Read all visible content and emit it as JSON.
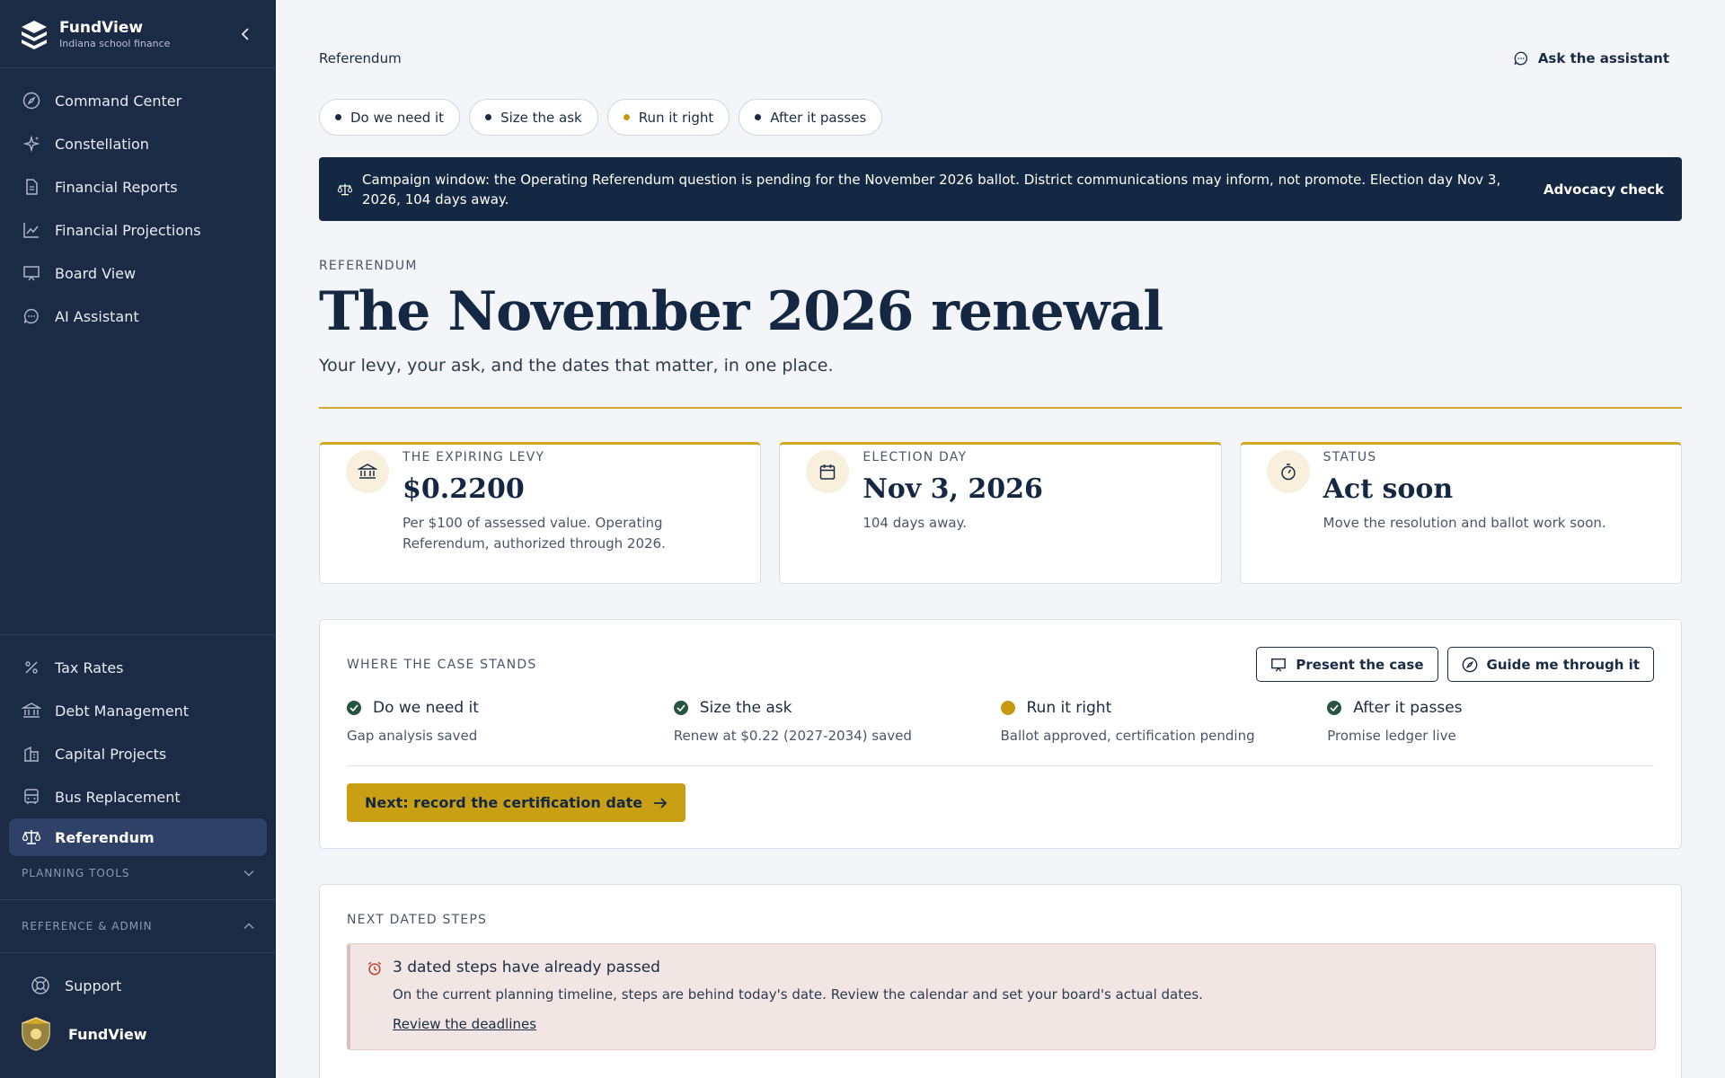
{
  "app": {
    "name": "FundView",
    "tagline": "Indiana school finance"
  },
  "sidebar": {
    "primary": [
      {
        "label": "Command Center",
        "icon": "compass-icon"
      },
      {
        "label": "Constellation",
        "icon": "sparkle-icon"
      },
      {
        "label": "Financial Reports",
        "icon": "document-icon"
      },
      {
        "label": "Financial Projections",
        "icon": "trend-chart-icon"
      },
      {
        "label": "Board View",
        "icon": "presentation-icon"
      },
      {
        "label": "AI Assistant",
        "icon": "chat-icon"
      }
    ],
    "secondary": [
      {
        "label": "Tax Rates",
        "icon": "percent-icon"
      },
      {
        "label": "Debt Management",
        "icon": "bank-icon"
      },
      {
        "label": "Capital Projects",
        "icon": "building-icon"
      },
      {
        "label": "Bus Replacement",
        "icon": "bus-icon"
      },
      {
        "label": "Referendum",
        "icon": "scales-icon",
        "active": true
      }
    ],
    "planning_tools": "PLANNING TOOLS",
    "reference_admin": "REFERENCE & ADMIN",
    "support": "Support",
    "user": "FundView"
  },
  "topbar": {
    "breadcrumb": "Referendum",
    "assistant": "Ask the assistant"
  },
  "chips": [
    {
      "label": "Do we need it",
      "state": "normal"
    },
    {
      "label": "Size the ask",
      "state": "normal"
    },
    {
      "label": "Run it right",
      "state": "current"
    },
    {
      "label": "After it passes",
      "state": "normal"
    }
  ],
  "banner": {
    "text": "Campaign window: the Operating Referendum question is pending for the November 2026 ballot. District communications may inform, not promote. Election day Nov 3, 2026, 104 days away.",
    "action": "Advocacy check"
  },
  "page": {
    "eyebrow": "REFERENDUM",
    "title": "The November 2026 renewal",
    "subtitle": "Your levy, your ask, and the dates that matter, in one place."
  },
  "stats": [
    {
      "label": "THE EXPIRING LEVY",
      "value": "$0.2200",
      "note": "Per $100 of assessed value. Operating Referendum, authorized through 2026.",
      "icon": "bank-icon"
    },
    {
      "label": "ELECTION DAY",
      "value": "Nov 3, 2026",
      "note": "104 days away.",
      "icon": "calendar-icon"
    },
    {
      "label": "STATUS",
      "value": "Act soon",
      "note": "Move the resolution and ballot work soon.",
      "icon": "stopwatch-icon"
    }
  ],
  "case": {
    "label": "WHERE THE CASE STANDS",
    "present_btn": "Present the case",
    "guide_btn": "Guide me through it",
    "steps": [
      {
        "title": "Do we need it",
        "detail": "Gap analysis saved",
        "status": "done"
      },
      {
        "title": "Size the ask",
        "detail": "Renew at $0.22 (2027-2034) saved",
        "status": "done"
      },
      {
        "title": "Run it right",
        "detail": "Ballot approved, certification pending",
        "status": "current"
      },
      {
        "title": "After it passes",
        "detail": "Promise ledger live",
        "status": "done"
      }
    ],
    "next_btn": "Next: record the certification date"
  },
  "dated_steps": {
    "label": "NEXT DATED STEPS",
    "alert_title": "3 dated steps have already passed",
    "alert_body": "On the current planning timeline, steps are behind today's date. Review the calendar and set your board's actual dates.",
    "alert_link": "Review the deadlines"
  },
  "colors": {
    "sidebar": "#1b2a45",
    "accent_gold": "#d4a827",
    "navy": "#142843",
    "success": "#27533f",
    "alert_bg": "#f1e6e3"
  }
}
